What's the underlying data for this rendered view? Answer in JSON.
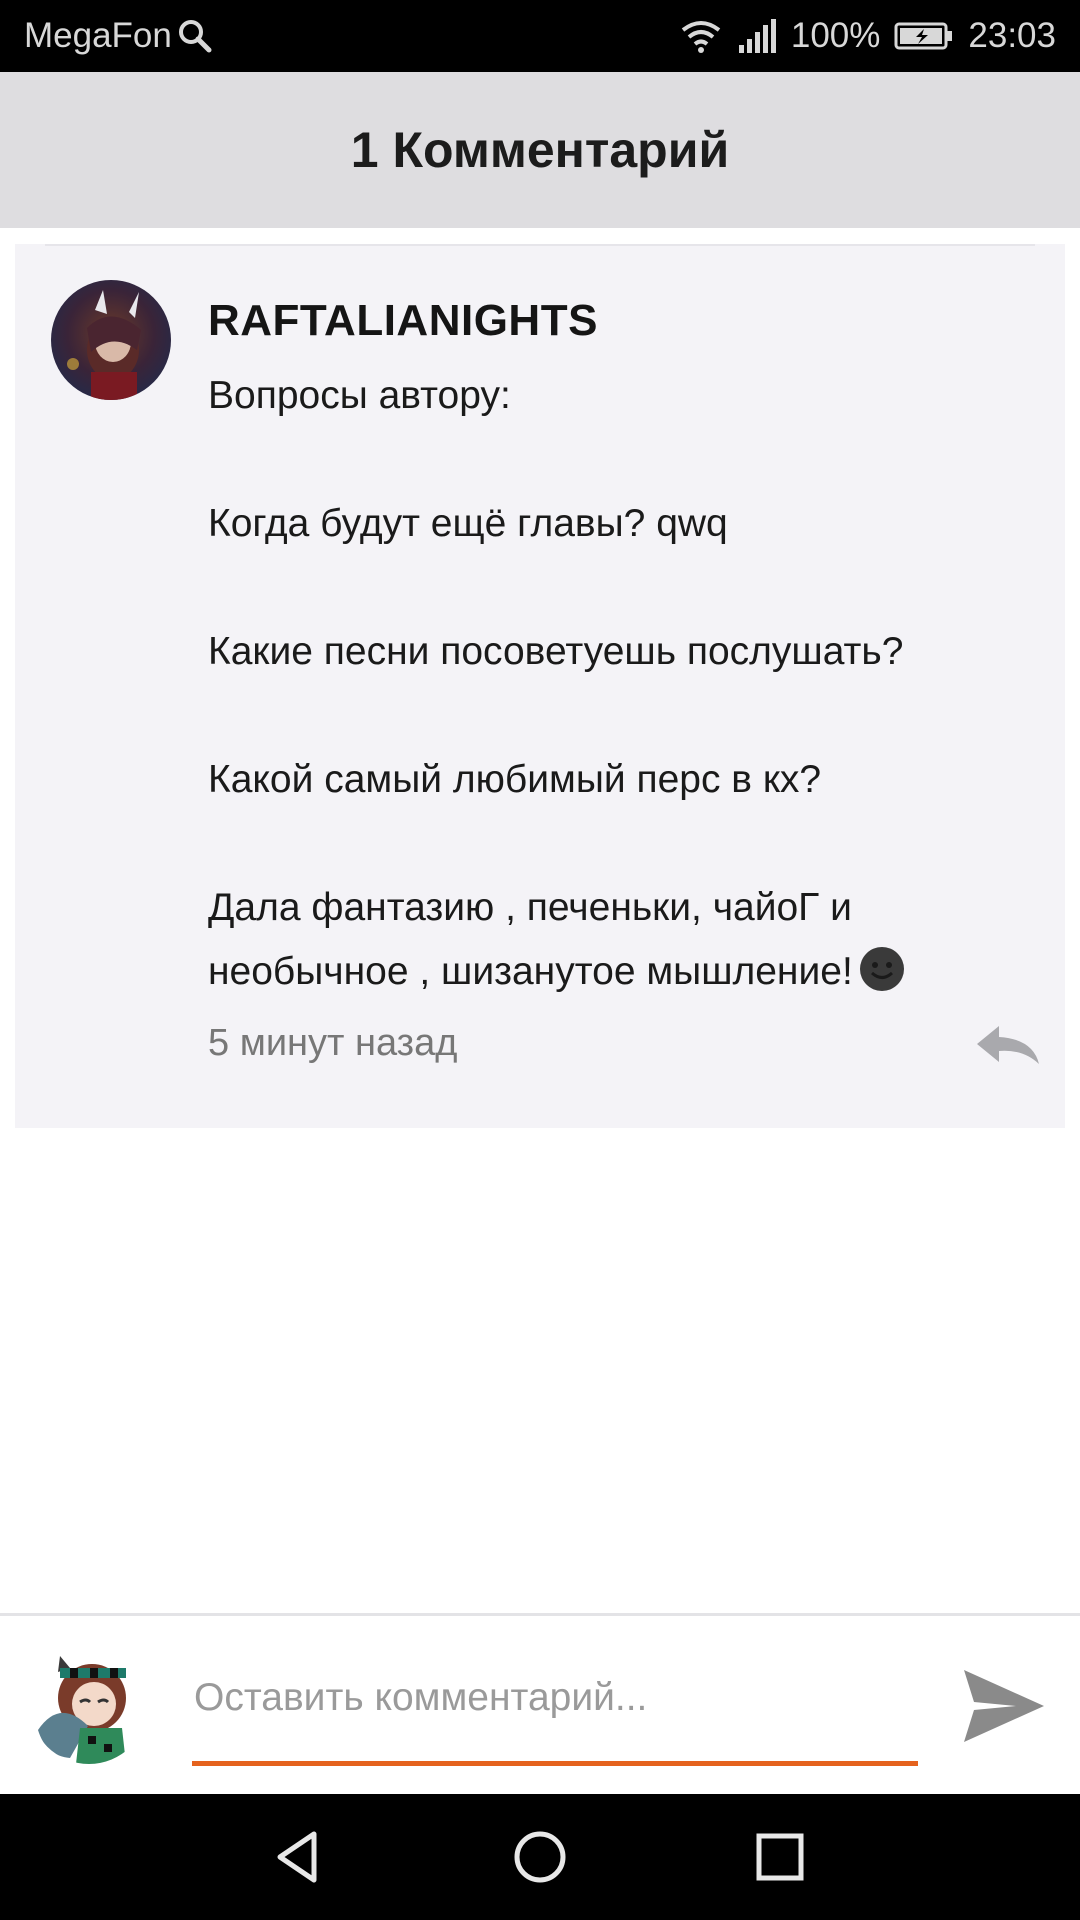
{
  "status_bar": {
    "carrier": "MegaFon",
    "battery": "100%",
    "time": "23:03"
  },
  "header": {
    "title": "1 Комментарий"
  },
  "comment": {
    "username": "RAFTALIANIGHTS",
    "text": "Вопросы автору:\n\nКогда будут ещё главы? qwq\n\nКакие песни посоветуешь послушать?\n\nКакой самый любимый перс в кх?\n\nДала фантазию , печеньки, чайоГ и необычное , шизанутое мышление!",
    "time_ago": "5 минут назад"
  },
  "input": {
    "placeholder": "Оставить комментарий..."
  },
  "colors": {
    "accent": "#e5631e",
    "header_bg": "#dedde0",
    "card_bg": "#f4f3f7"
  },
  "icons": [
    "search-icon",
    "wifi-icon",
    "signal-icon",
    "battery-icon",
    "reply-icon",
    "send-icon",
    "back-icon",
    "home-icon",
    "recents-icon",
    "emoji-icon"
  ]
}
